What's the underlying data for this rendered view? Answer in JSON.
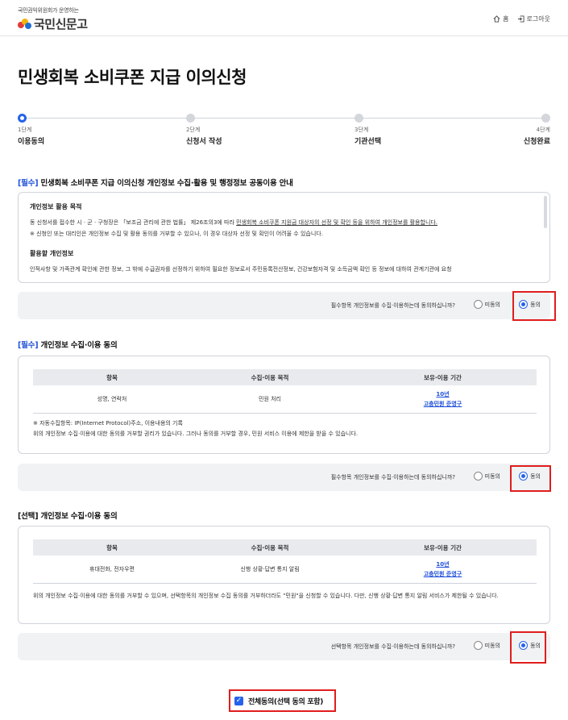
{
  "header": {
    "logo_sub": "국민권익위원회가 운영하는",
    "logo_main": "국민신문고",
    "nav": [
      {
        "label": "홈",
        "icon": "home-icon"
      },
      {
        "label": "로그아웃",
        "icon": "logout-icon"
      }
    ]
  },
  "page_title": "민생회복 소비쿠폰 지급 이의신청",
  "steps": [
    {
      "num": "1단계",
      "label": "이용동의",
      "active": true
    },
    {
      "num": "2단계",
      "label": "신청서 작성",
      "active": false
    },
    {
      "num": "3단계",
      "label": "기관선택",
      "active": false
    },
    {
      "num": "4단계",
      "label": "신청완료",
      "active": false
    }
  ],
  "section1": {
    "tag": "[필수]",
    "title": " 민생회복 소비쿠폰 지급 이의신청 개인정보 수집·활용 및 행정정보 공동이용 안내",
    "h1": "개인정보 활용 목적",
    "p1a": "동 신청서를 접수한 시 · 군 · 구청장은 「보조금 관리에 관한 법률」 제26조의3에 따라 ",
    "p1b": "민생회복 소비쿠폰 지원금 대상자의 선정 및 확인 등을 위하여 개인정보를 활용합니다.",
    "p2": "※ 신청인 또는 대리인은 개인정보 수집 및 활용 동의를 거부할 수 있으나, 이 경우 대상자 선정 및 확인이 어려울 수 있습니다.",
    "h2": "활용할 개인정보",
    "p3": "인적사항 및 가족관계 확인에 관한 정보, 그 밖에 수급권자를 선정하기 위하여 필요한 정보로서 주민등록전산정보, 건강보험자격 및 소득금액 확인 등 정보에 대하여 관계기관에 요청",
    "question": "필수항목 개인정보를 수집·이용하는데 동의하십니까?",
    "disagree": "미동의",
    "agree": "동의"
  },
  "section2": {
    "tag": "[필수]",
    "title": " 개인정보 수집·이용 동의",
    "headers": [
      "항목",
      "수집·이용 목적",
      "보유·이용 기간"
    ],
    "row": [
      "성명, 연락처",
      "민원 처리"
    ],
    "period1": "10년",
    "period2": "고충민원 준영구",
    "note1": "※ 자동수집항목: IP(Internet Protocol)주소, 이용내용의 기록",
    "note2": "위의 개인정보 수집·이용에 대한 동의를 거부할 권리가 있습니다. 그러나 동의를 거부할 경우, 민원 서비스 이용에 제한을 받을 수 있습니다.",
    "question": "필수항목 개인정보를 수집·이용하는데 동의하십니까?",
    "disagree": "미동의",
    "agree": "동의"
  },
  "section3": {
    "tag": "[선택]",
    "title": " 개인정보 수집·이용 동의",
    "headers": [
      "항목",
      "수집·이용 목적",
      "보유·이용 기간"
    ],
    "row": [
      "휴대전화, 전자우편",
      "신행 상황·답변 통지 알림"
    ],
    "period1": "10년",
    "period2": "고충민원 준영구",
    "note": "위의 개인정보 수집·이용에 대한 동의를 거부할 수 있으며, 선택항목의 개인정보 수집 동의를 거부하더라도 \"민원\"을 신청할 수 있습니다. 다만, 신행 상황·답변 통지 알림 서비스가 제한될 수 있습니다.",
    "question": "선택항목 개인정보를 수집·이용하는데 동의하십니까?",
    "disagree": "미동의",
    "agree": "동의"
  },
  "all_agree": "전체동의(선택 동의 포함)",
  "colors": {
    "accent": "#2563eb",
    "highlight": "#e11d1d"
  }
}
